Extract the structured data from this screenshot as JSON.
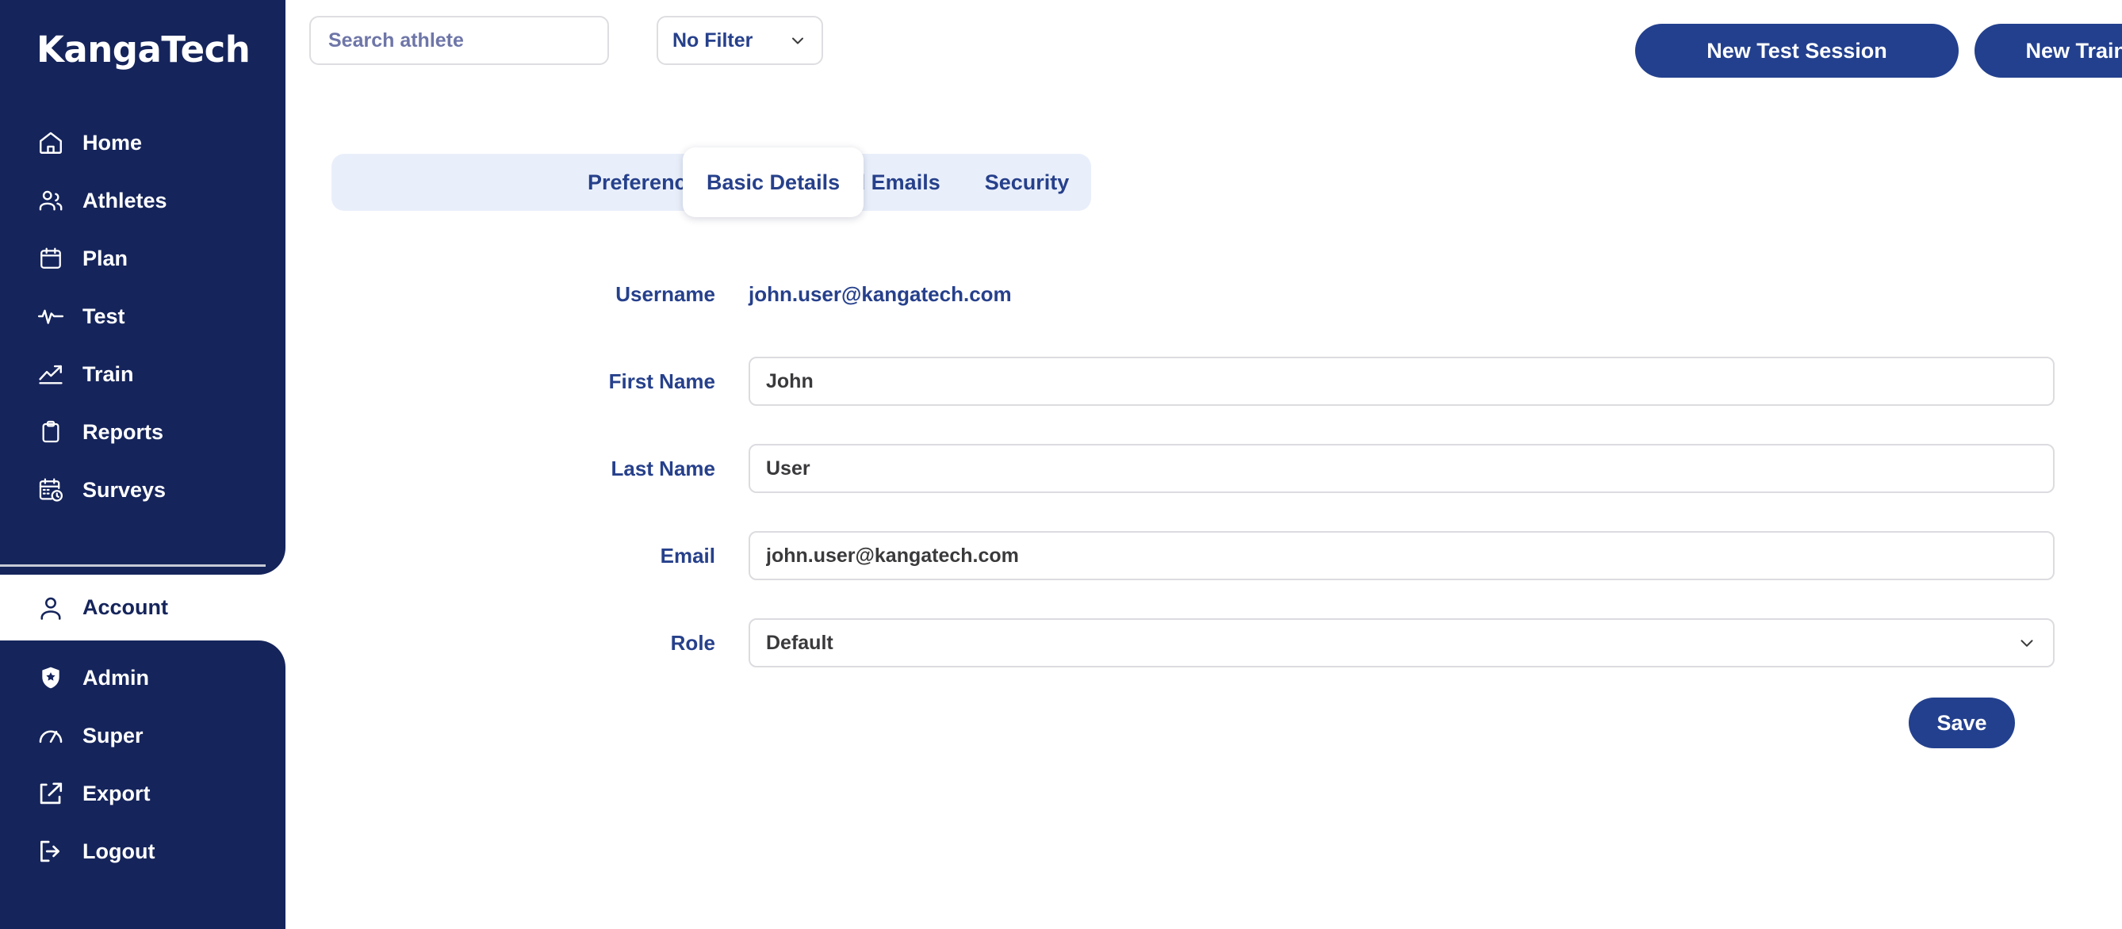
{
  "brand": {
    "name": "KangaTech"
  },
  "sidebar": {
    "primary_items": [
      {
        "label": "Home",
        "icon": "home-icon"
      },
      {
        "label": "Athletes",
        "icon": "users-icon"
      },
      {
        "label": "Plan",
        "icon": "calendar-icon"
      },
      {
        "label": "Test",
        "icon": "pulse-icon"
      },
      {
        "label": "Train",
        "icon": "trending-up-icon"
      },
      {
        "label": "Reports",
        "icon": "clipboard-icon"
      },
      {
        "label": "Surveys",
        "icon": "calendar-clock-icon"
      }
    ],
    "account_item": {
      "label": "Account",
      "icon": "user-icon",
      "active": true
    },
    "secondary_items": [
      {
        "label": "Admin",
        "icon": "shield-star-icon"
      },
      {
        "label": "Super",
        "icon": "gauge-icon"
      },
      {
        "label": "Export",
        "icon": "share-export-icon"
      },
      {
        "label": "Logout",
        "icon": "logout-icon"
      }
    ]
  },
  "topbar": {
    "search": {
      "placeholder": "Search athlete",
      "value": ""
    },
    "filter": {
      "selected": "No Filter",
      "icon": "chevron-down-icon"
    },
    "new_test_session": "New Test Session",
    "new_training_session": "New Training Session"
  },
  "tabs": [
    {
      "label": "Basic Details",
      "active": true
    },
    {
      "label": "Preferences",
      "active": false
    },
    {
      "label": "Registered Emails",
      "active": false
    },
    {
      "label": "Security",
      "active": false
    }
  ],
  "form": {
    "username": {
      "label": "Username",
      "value": "john.user@kangatech.com"
    },
    "first_name": {
      "label": "First Name",
      "value": "John"
    },
    "last_name": {
      "label": "Last Name",
      "value": "User"
    },
    "email": {
      "label": "Email",
      "value": "john.user@kangatech.com"
    },
    "role": {
      "label": "Role",
      "value": "Default",
      "icon": "chevron-down-icon"
    },
    "save_label": "Save"
  },
  "colors": {
    "navy": "#15245B",
    "accent_blue": "#23408E",
    "label_blue": "#26408B",
    "tabbar_bg": "#E9EFFA",
    "placeholder": "#6E76A8",
    "input_border": "#DCDCE0"
  }
}
